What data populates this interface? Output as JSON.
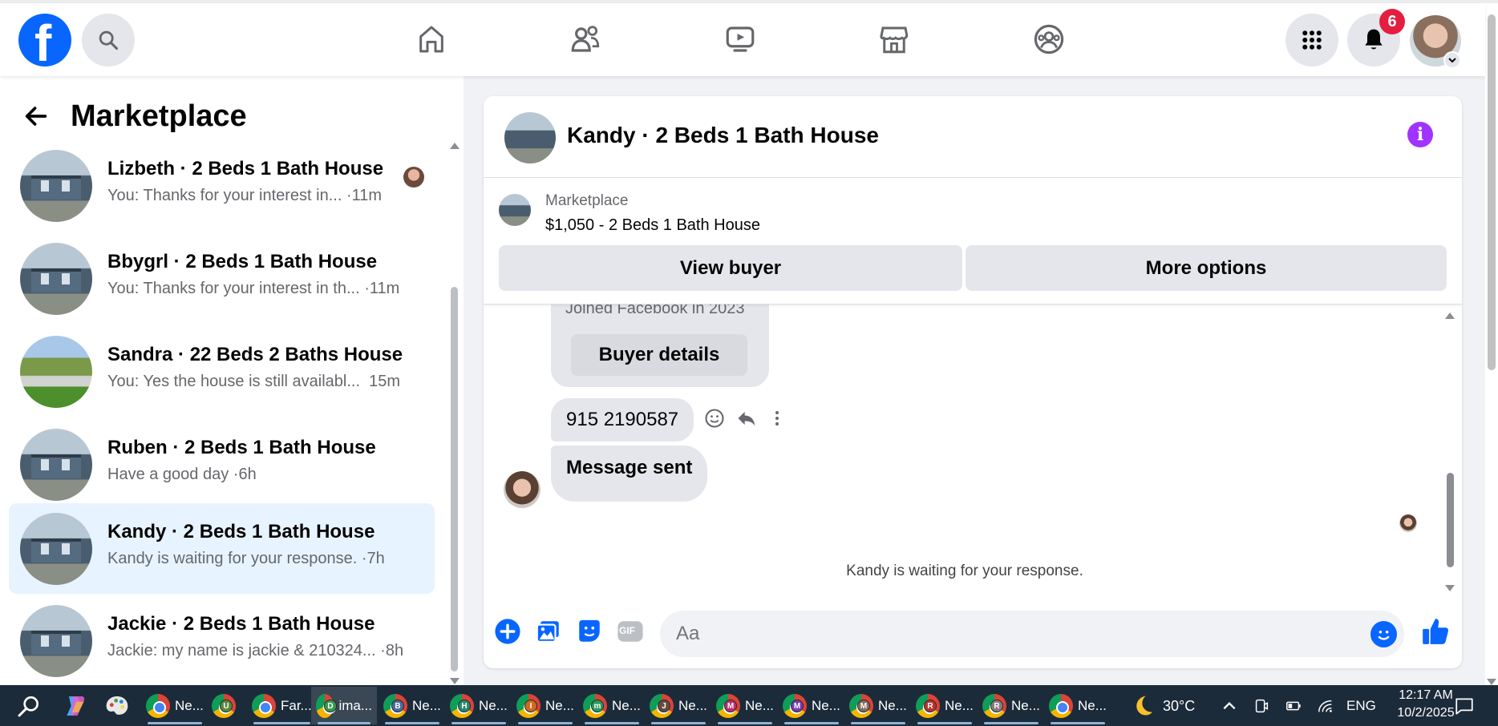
{
  "header": {
    "logo_letter": "f",
    "notifications_count": "6"
  },
  "left": {
    "title": "Marketplace",
    "conversations": [
      {
        "title": "Lizbeth · 2 Beds 1 Bath House",
        "preview": "You: Thanks for your interest in...",
        "time": "·11m"
      },
      {
        "title": "Bbygrl · 2 Beds 1 Bath House",
        "preview": "You: Thanks for your interest in th...",
        "time": "·11m"
      },
      {
        "title": "Sandra · 22 Beds 2 Baths House",
        "preview": "You: Yes the house is still availabl...",
        "time": "15m"
      },
      {
        "title": "Ruben · 2 Beds 1 Bath House",
        "preview": "Have a good day",
        "time": "·6h"
      },
      {
        "title": "Kandy · 2 Beds 1 Bath House",
        "preview": "Kandy is waiting for your response.",
        "time": "·7h"
      },
      {
        "title": "Jackie · 2 Beds 1 Bath House",
        "preview": "Jackie: my name is jackie & 210324...",
        "time": "·8h"
      }
    ]
  },
  "chat": {
    "title": "Kandy · 2 Beds 1 Bath House",
    "listing_category": "Marketplace",
    "listing_price": "$1,050 - 2 Beds 1 Bath House",
    "view_buyer_label": "View buyer",
    "more_options_label": "More options",
    "joined_text": "Joined Facebook in 2023",
    "buyer_details_label": "Buyer details",
    "message_1": "915 2190587",
    "message_2": "Message sent",
    "waiting_text": "Kandy is waiting for your response.",
    "input_placeholder": "Aa",
    "gif_label": "GIF"
  },
  "taskbar": {
    "apps": [
      {
        "label": "Ne...",
        "letter": "",
        "color": "#4a7bd1"
      },
      {
        "label": "",
        "letter": "U",
        "color": "#5b8a3a"
      },
      {
        "label": "Far...",
        "letter": "",
        "color": "#8a5a3a"
      },
      {
        "label": "ima...",
        "letter": "D",
        "color": "#3a9a4a"
      },
      {
        "label": "Ne...",
        "letter": "B",
        "color": "#4a6a9a"
      },
      {
        "label": "Ne...",
        "letter": "H",
        "color": "#2a8a6a"
      },
      {
        "label": "Ne...",
        "letter": "I",
        "color": "#d06a1a"
      },
      {
        "label": "Ne...",
        "letter": "m",
        "color": "#2a9a5a"
      },
      {
        "label": "Ne...",
        "letter": "J",
        "color": "#6a4a3a"
      },
      {
        "label": "Ne...",
        "letter": "M",
        "color": "#c02a6a"
      },
      {
        "label": "Ne...",
        "letter": "M",
        "color": "#7a3aaa"
      },
      {
        "label": "Ne...",
        "letter": "M",
        "color": "#8a6a5a"
      },
      {
        "label": "Ne...",
        "letter": "R",
        "color": "#c0302a"
      },
      {
        "label": "Ne...",
        "letter": "R",
        "color": "#8a7a7a"
      },
      {
        "label": "Ne...",
        "letter": "",
        "color": "#d04a2a"
      }
    ],
    "weather": "30°C",
    "language": "ENG",
    "time": "12:17 AM",
    "date": "10/2/2025"
  }
}
